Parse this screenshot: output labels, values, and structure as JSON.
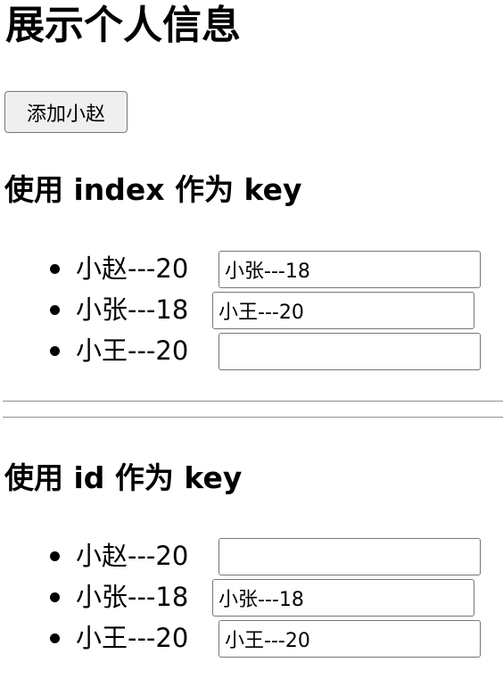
{
  "page": {
    "title": "展示个人信息",
    "add_button_label": "添加小赵"
  },
  "index_section": {
    "heading": "使用 index 作为 key",
    "items": [
      {
        "label": "小赵---20",
        "input_value": "小张---18"
      },
      {
        "label": "小张---18",
        "input_value": "小王---20"
      },
      {
        "label": "小王---20",
        "input_value": ""
      }
    ]
  },
  "id_section": {
    "heading": "使用 id 作为 key",
    "items": [
      {
        "label": "小赵---20",
        "input_value": ""
      },
      {
        "label": "小张---18",
        "input_value": "小张---18"
      },
      {
        "label": "小王---20",
        "input_value": "小王---20"
      }
    ]
  }
}
